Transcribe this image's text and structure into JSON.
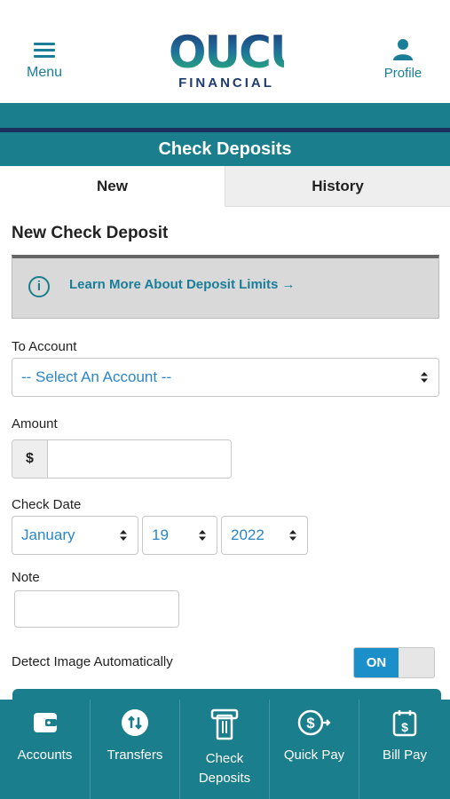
{
  "header": {
    "menu_label": "Menu",
    "logo_mark": "OUCU",
    "logo_sub": "FINANCIAL",
    "profile_label": "Profile"
  },
  "page_title": "Check Deposits",
  "tabs": [
    {
      "label": "New",
      "active": true
    },
    {
      "label": "History",
      "active": false
    }
  ],
  "form": {
    "section_title": "New Check Deposit",
    "info_link": "Learn More About Deposit Limits →",
    "to_account_label": "To Account",
    "to_account_value": "-- Select An Account --",
    "amount_label": "Amount",
    "amount_prefix": "$",
    "amount_value": "",
    "check_date_label": "Check Date",
    "check_month": "January",
    "check_day": "19",
    "check_year": "2022",
    "note_label": "Note",
    "note_value": "",
    "detect_label": "Detect Image Automatically",
    "detect_toggle": "ON"
  },
  "bottom_nav": [
    {
      "label": "Accounts",
      "icon": "wallet-icon"
    },
    {
      "label": "Transfers",
      "icon": "transfer-icon"
    },
    {
      "label": "Check Deposits",
      "icon": "check-deposit-icon"
    },
    {
      "label": "Quick Pay",
      "icon": "quick-pay-icon"
    },
    {
      "label": "Bill Pay",
      "icon": "bill-pay-icon"
    }
  ],
  "colors": {
    "teal": "#1a7e8c",
    "navy": "#1a2f5e",
    "link_blue": "#2a86c7",
    "toggle_blue": "#1a8fc9"
  }
}
